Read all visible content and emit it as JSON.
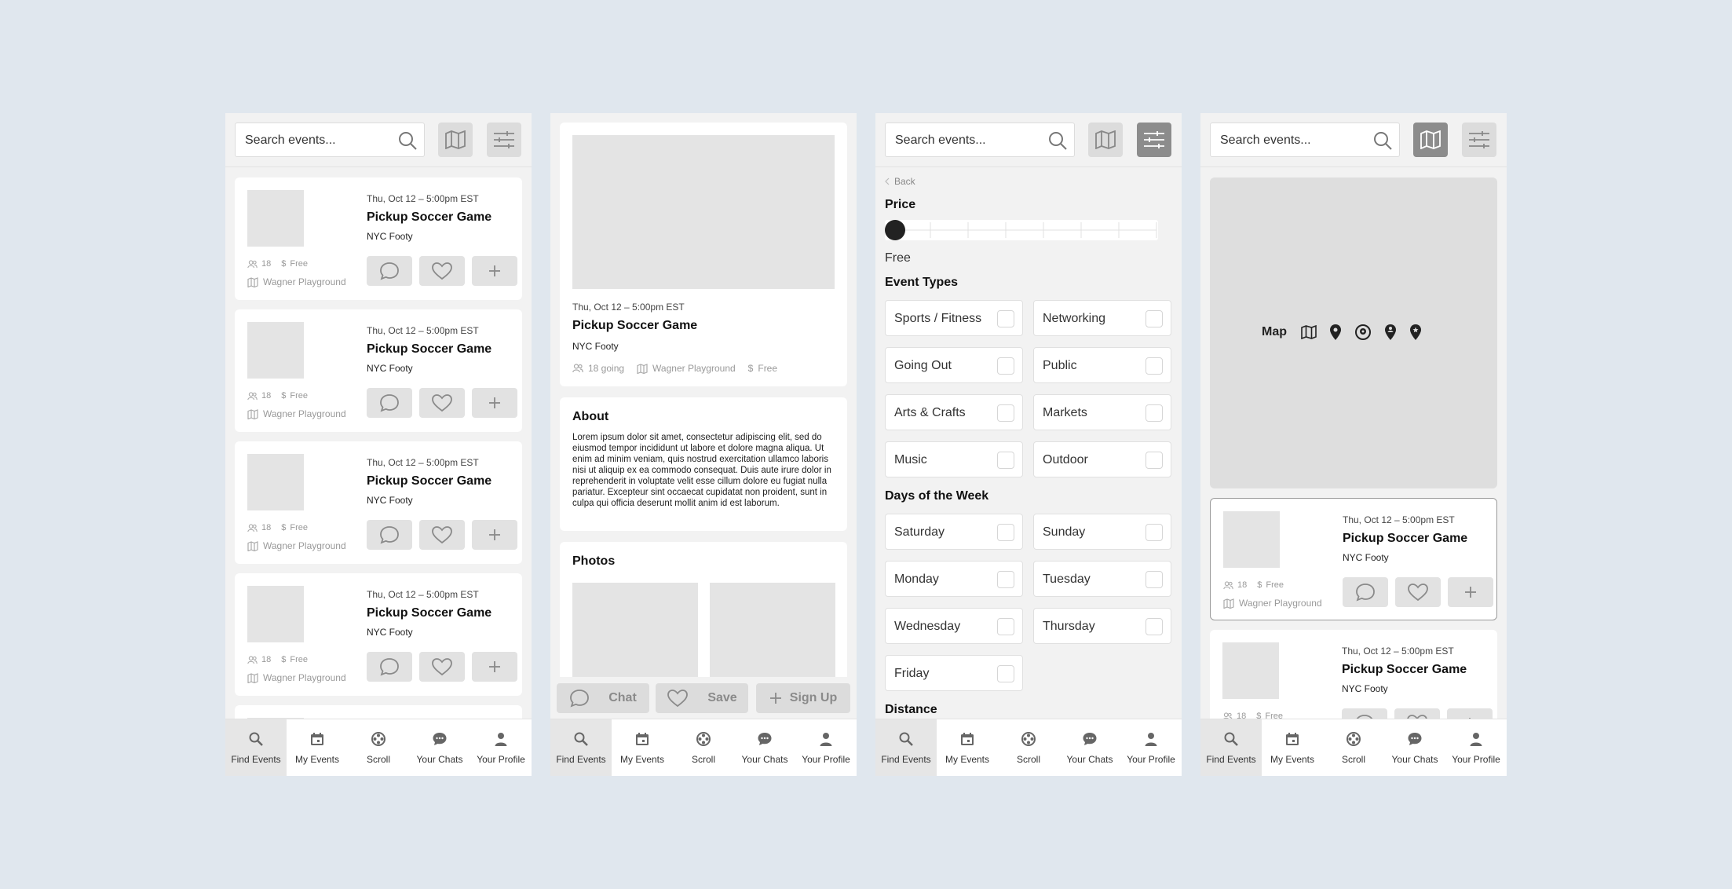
{
  "search": {
    "placeholder": "Search events..."
  },
  "event": {
    "date": "Thu, Oct 12 – 5:00pm EST",
    "title": "Pickup Soccer Game",
    "org": "NYC Footy",
    "attendees": "18",
    "price_symbol": "$",
    "price": "Free",
    "location": "Wagner Playground",
    "going": "18 going"
  },
  "nav": [
    "Find Events",
    "My Events",
    "Scroll",
    "Your Chats",
    "Your Profile"
  ],
  "detail": {
    "about_title": "About",
    "about_text": "Lorem ipsum dolor sit amet, consectetur adipiscing elit, sed do eiusmod tempor incididunt ut labore et dolore magna aliqua. Ut enim ad minim veniam, quis nostrud exercitation ullamco laboris nisi ut aliquip ex ea commodo consequat. Duis aute irure dolor in reprehenderit in voluptate velit esse cillum dolore eu fugiat nulla pariatur. Excepteur sint occaecat cupidatat non proident, sunt in culpa qui officia deserunt mollit anim id est laborum.",
    "photos_title": "Photos",
    "actions": {
      "chat": "Chat",
      "save": "Save",
      "signup": "Sign Up"
    }
  },
  "filters": {
    "back": "Back",
    "price_title": "Price",
    "price_value": "Free",
    "price_slider_level": 0,
    "event_types_title": "Event Types",
    "event_types": [
      "Sports / Fitness",
      "Networking",
      "Going Out",
      "Public",
      "Arts & Crafts",
      "Markets",
      "Music",
      "Outdoor"
    ],
    "days_title": "Days of the Week",
    "days": [
      "Saturday",
      "Sunday",
      "Monday",
      "Tuesday",
      "Wednesday",
      "Thursday",
      "Friday"
    ],
    "distance_title": "Distance"
  },
  "map": {
    "label": "Map"
  },
  "icons": {
    "search": "search-icon",
    "map": "map-icon",
    "filter": "sliders-icon",
    "people": "people-icon",
    "chat": "chat-bubble-icon",
    "heart": "heart-icon",
    "plus": "plus-icon",
    "nav": [
      "magnifier-icon",
      "calendar-icon",
      "reel-icon",
      "chat-icon",
      "person-icon"
    ],
    "pins": [
      "map-icon",
      "pin-icon",
      "target-pin-icon",
      "person-pin-icon",
      "star-pin-icon"
    ]
  }
}
